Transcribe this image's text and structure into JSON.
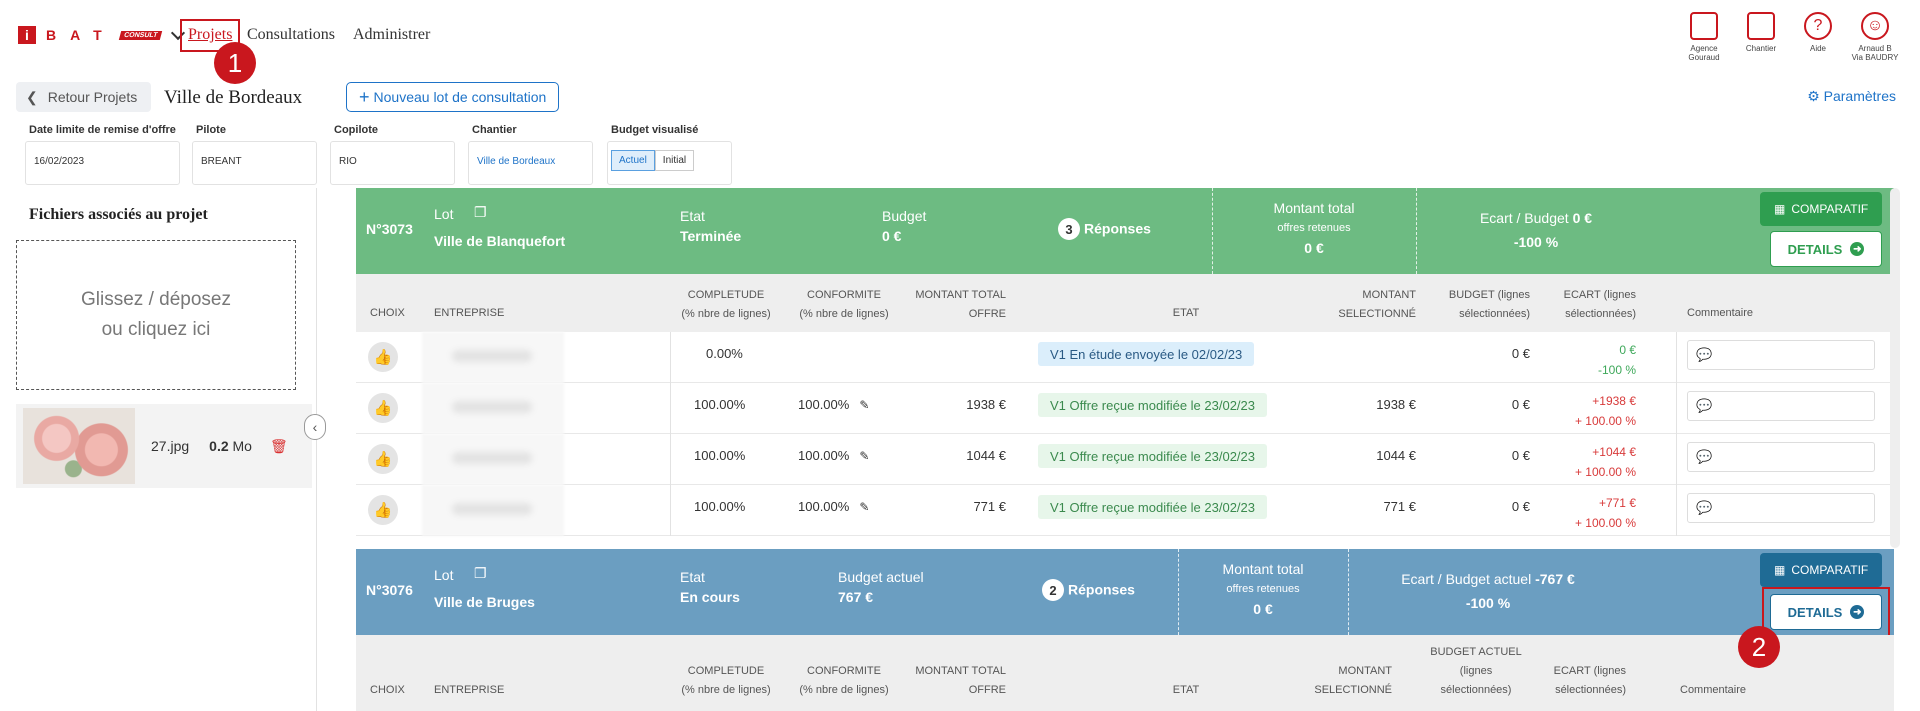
{
  "brand": {
    "logo_i": "i",
    "logo_letters": "BAT",
    "logo_consult": "CONSULT"
  },
  "nav": {
    "projets": "Projets",
    "consultations": "Consultations",
    "administrer": "Administrer"
  },
  "annotations": {
    "step1": "1",
    "step2": "2"
  },
  "top_icons": [
    {
      "name": "building-icon",
      "label1": "Agence",
      "label2": "Gouraud"
    },
    {
      "name": "crane-icon",
      "label1": "Chantier",
      "label2": ""
    },
    {
      "name": "help-icon",
      "label1": "Aide",
      "label2": ""
    },
    {
      "name": "user-icon",
      "label1": "Arnaud B",
      "label2": "Via BAUDRY"
    }
  ],
  "subbar": {
    "back_label": "Retour Projets",
    "title": "Ville de Bordeaux",
    "new_lot_label": "Nouveau lot de consultation",
    "params_label": "Paramètres"
  },
  "fields": {
    "date_label": "Date limite de remise d'offre",
    "date_value": "16/02/2023",
    "pilote_label": "Pilote",
    "pilote_value": "BREANT",
    "copilote_label": "Copilote",
    "copilote_value": "RIO",
    "chantier_label": "Chantier",
    "chantier_value": "Ville de Bordeaux",
    "budget_label": "Budget visualisé",
    "budget_opt1": "Actuel",
    "budget_opt2": "Initial"
  },
  "left_panel": {
    "title": "Fichiers associés au projet",
    "drop_line1": "Glissez / déposez",
    "drop_line2": "ou cliquez ici",
    "file_name": "27.jpg",
    "file_size_num": "0.2",
    "file_size_unit": "Mo"
  },
  "lot1": {
    "num": "N°3073",
    "lot_label": "Lot",
    "name": "Ville de Blanquefort",
    "etat_label": "Etat",
    "etat_value": "Terminée",
    "budget_label": "Budget",
    "budget_value": "0 €",
    "responses_count": "3",
    "responses_label": "Réponses",
    "montant_label1": "Montant total",
    "montant_label2": "offres retenues",
    "montant_value": "0 €",
    "ecart_label": "Ecart / Budget",
    "ecart_amount": "0 €",
    "ecart_pct": "-100 %",
    "comparatif_label": "COMPARATIF",
    "details_label": "DETAILS"
  },
  "table1_headers": {
    "choix": "CHOIX",
    "entreprise": "ENTREPRISE",
    "completude1": "COMPLETUDE",
    "completude2": "(% nbre de lignes)",
    "conformite1": "CONFORMITE",
    "conformite2": "(% nbre de lignes)",
    "montant1": "MONTANT TOTAL",
    "montant2": "OFFRE",
    "etat": "ETAT",
    "msel1": "MONTANT",
    "msel2": "SELECTIONNÉ",
    "budget1": "BUDGET (lignes",
    "budget2": "sélectionnées)",
    "ecart1": "ECART (lignes",
    "ecart2": "sélectionnées)",
    "commentaire": "Commentaire"
  },
  "rows": [
    {
      "completude": "0.00%",
      "conformite": "",
      "montant": "",
      "etat": "V1 En étude envoyée le 02/02/23",
      "etat_type": "blue",
      "msel": "",
      "budget": "0 €",
      "ecart1": "0 €",
      "ecart2": "-100 %",
      "ecart_color": "g"
    },
    {
      "completude": "100.00%",
      "conformite": "100.00%",
      "montant": "1938 €",
      "etat": "V1 Offre reçue modifiée le 23/02/23",
      "etat_type": "green",
      "msel": "1938 €",
      "budget": "0 €",
      "ecart1": "+1938 €",
      "ecart2": "+ 100.00 %",
      "ecart_color": "r"
    },
    {
      "completude": "100.00%",
      "conformite": "100.00%",
      "montant": "1044 €",
      "etat": "V1 Offre reçue modifiée le 23/02/23",
      "etat_type": "green",
      "msel": "1044 €",
      "budget": "0 €",
      "ecart1": "+1044 €",
      "ecart2": "+ 100.00 %",
      "ecart_color": "r"
    },
    {
      "completude": "100.00%",
      "conformite": "100.00%",
      "montant": "771 €",
      "etat": "V1 Offre reçue modifiée le 23/02/23",
      "etat_type": "green",
      "msel": "771 €",
      "budget": "0 €",
      "ecart1": "+771 €",
      "ecart2": "+ 100.00 %",
      "ecart_color": "r"
    }
  ],
  "lot2": {
    "num": "N°3076",
    "lot_label": "Lot",
    "name": "Ville de Bruges",
    "etat_label": "Etat",
    "etat_value": "En cours",
    "budget_label": "Budget actuel",
    "budget_value": "767 €",
    "responses_count": "2",
    "responses_label": "Réponses",
    "montant_label1": "Montant total",
    "montant_label2": "offres retenues",
    "montant_value": "0 €",
    "ecart_label": "Ecart / Budget actuel",
    "ecart_amount": "-767 €",
    "ecart_pct": "-100 %",
    "comparatif_label": "COMPARATIF",
    "details_label": "DETAILS"
  },
  "table2_headers": {
    "choix": "CHOIX",
    "entreprise": "ENTREPRISE",
    "completude1": "COMPLETUDE",
    "completude2": "(% nbre de lignes)",
    "conformite1": "CONFORMITE",
    "conformite2": "(% nbre de lignes)",
    "montant1": "MONTANT TOTAL",
    "montant2": "OFFRE",
    "etat": "ETAT",
    "msel1": "MONTANT",
    "msel2": "SELECTIONNÉ",
    "budget1": "BUDGET ACTUEL",
    "budget2": "(lignes",
    "budget3": "sélectionnées)",
    "ecart1": "ECART (lignes",
    "ecart2": "sélectionnées)",
    "commentaire": "Commentaire"
  },
  "colors": {
    "green_header": "#6dbb82",
    "blue_header": "#6b9ec1",
    "accent_red": "#c9171e",
    "link_blue": "#1e73c8"
  }
}
